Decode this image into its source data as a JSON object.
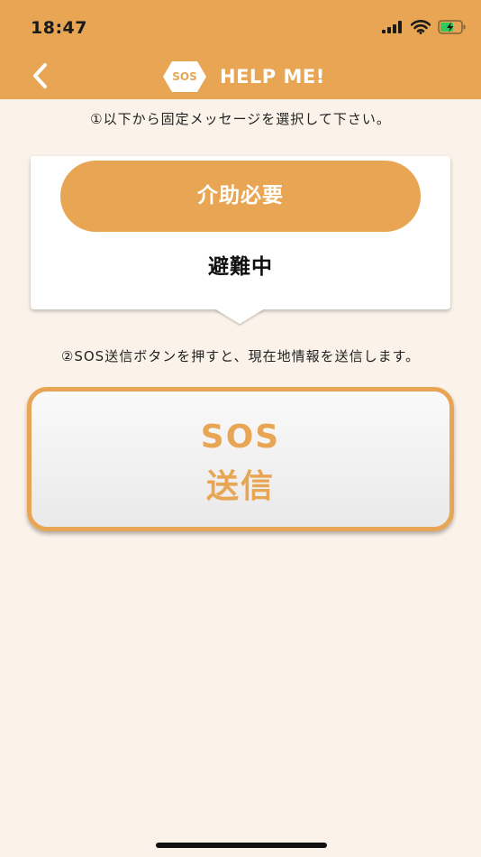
{
  "status_bar": {
    "time": "18:47",
    "icons": [
      "cellular-signal-icon",
      "wifi-icon",
      "battery-charging-icon"
    ]
  },
  "header": {
    "logo_text": "SOS",
    "title": "HELP ME!",
    "back_icon": "chevron-left-icon"
  },
  "instructions": {
    "step1": "①以下から固定メッセージを選択して下さい。",
    "step2": "②SOS送信ボタンを押すと、現在地情報を送信します。"
  },
  "messages": {
    "options": [
      "介助必要",
      "避難中"
    ],
    "selected": "介助必要"
  },
  "sos_button": {
    "line1": "SOS",
    "line2": "送信"
  },
  "colors": {
    "accent": "#E8A654",
    "background": "#FBF3EA",
    "card": "#FFFFFF",
    "text_dark": "#111111"
  }
}
